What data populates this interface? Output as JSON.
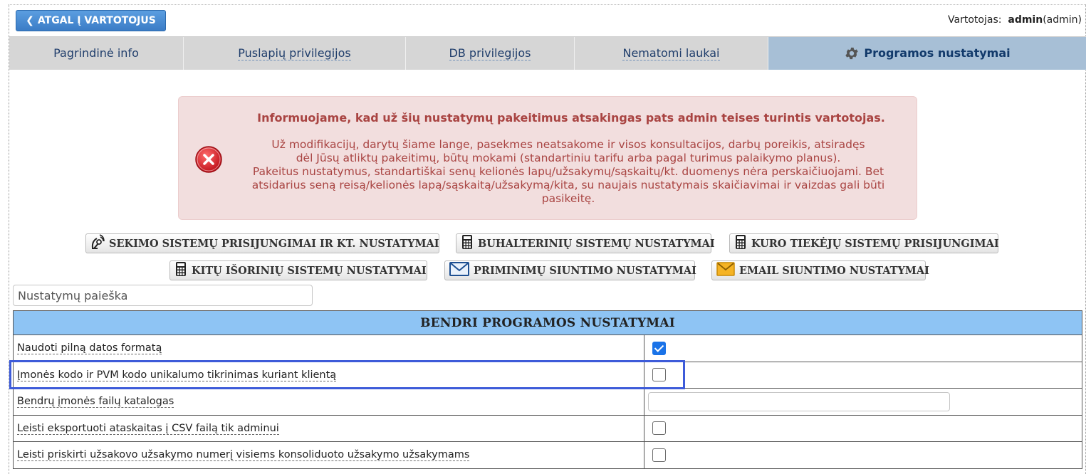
{
  "header": {
    "back_label": "ATGAL Į VARTOTOJUS",
    "user_prefix": "Vartotojas:",
    "user_name": "admin",
    "user_role": "(admin)"
  },
  "tabs": [
    {
      "label": "Pagrindinė info",
      "active": false
    },
    {
      "label": "Puslapių privilegijos",
      "active": false
    },
    {
      "label": "DB privilegijos",
      "active": false
    },
    {
      "label": "Nematomi laukai",
      "active": false
    },
    {
      "label": "Programos nustatymai",
      "active": true,
      "icon": "gear-icon"
    }
  ],
  "alert": {
    "title": "Informuojame, kad už šių nustatymų pakeitimus atsakingas pats admin teises turintis vartotojas.",
    "line1": "Už modifikacijų, darytų šiame lange, pasekmes neatsakome ir visos konsultacijos, darbų poreikis, atsiradęs",
    "line2": "dėl Jūsų atliktų pakeitimų, būtų mokami (standartiniu tarifu arba pagal turimus palaikymo planus).",
    "line3": "Pakeitus nustatymus, standartiškai senų kelionės lapų/užsakymų/sąskaitų/kt. duomenys nėra perskaičiuojami. Bet",
    "line4": "atsidarius seną reisą/kelionės lapą/sąskaitą/užsakymą/kita, su naujais nustatymais skaičiavimai ir vaizdas gali būti",
    "line5": "pasikeitę.",
    "icon": "error-icon",
    "color": "#a94442"
  },
  "tool_buttons": [
    {
      "label": "SEKIMO SISTEMŲ PRISIJUNGIMAI IR KT. NUSTATYMAI",
      "icon": "satellite-icon"
    },
    {
      "label": "BUHALTERINIŲ SISTEMŲ NUSTATYMAI",
      "icon": "calculator-icon"
    },
    {
      "label": "KURO TIEKĖJŲ SISTEMŲ PRISIJUNGIMAI",
      "icon": "calculator-icon"
    },
    {
      "label": "KITŲ IŠORINIŲ SISTEMŲ NUSTATYMAI",
      "icon": "calculator-icon"
    },
    {
      "label": "PRIMINIMŲ SIUNTIMO NUSTATYMAI",
      "icon": "envelope-icon"
    },
    {
      "label": "EMAIL SIUNTIMO NUSTATYMAI",
      "icon": "envelope-icon"
    }
  ],
  "search": {
    "placeholder": "Nustatymų paieška",
    "value": ""
  },
  "settings_table": {
    "header": "BENDRI PROGRAMOS NUSTATYMAI",
    "rows": [
      {
        "label": "Naudoti pilną datos formatą",
        "type": "checkbox",
        "checked": true
      },
      {
        "label": "Įmonės kodo ir PVM kodo unikalumo tikrinimas kuriant klientą",
        "type": "checkbox",
        "checked": false
      },
      {
        "label": "Bendrų įmonės failų katalogas",
        "type": "text",
        "value": ""
      },
      {
        "label": "Leisti eksportuoti ataskaitas į CSV failą tik adminui",
        "type": "checkbox",
        "checked": false
      },
      {
        "label": "Leisti priskirti užsakovo užsakymo numerį visiems konsoliduoto užsakymo užsakymams",
        "type": "checkbox",
        "checked": false
      }
    ]
  },
  "colors": {
    "accent": "#3b7cc6",
    "active_tab": "#a7bfd6",
    "table_header": "#8ec4f4",
    "highlight": "#3d5bd9",
    "checkbox_on": "#1a73e8"
  }
}
